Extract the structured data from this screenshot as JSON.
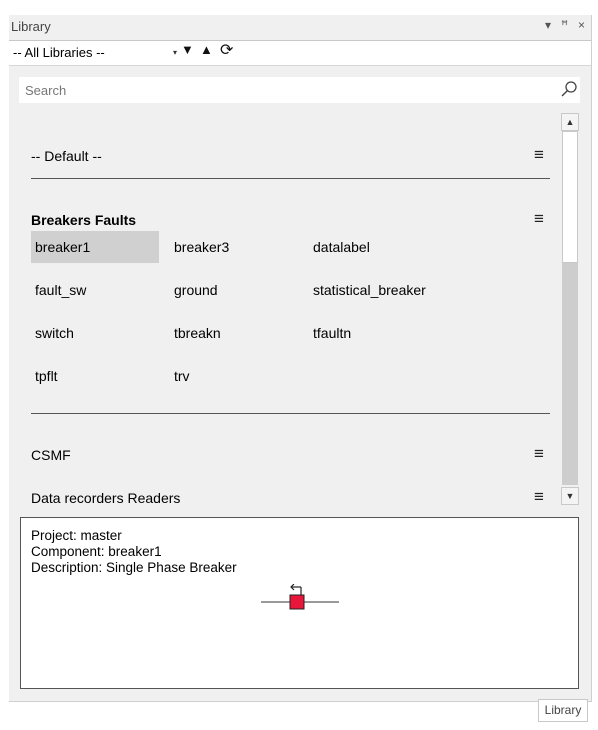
{
  "window": {
    "title": "Library",
    "dropdown_icon": "▾",
    "pin_icon": "ꟸ",
    "close_icon": "×"
  },
  "toolbar": {
    "library_select": "-- All Libraries --",
    "down_icon": "▼",
    "up_icon": "▲",
    "refresh_icon": "⟳"
  },
  "search": {
    "placeholder": "Search"
  },
  "categories": {
    "default": "-- Default --",
    "breakers": "Breakers Faults",
    "csmf": "CSMF",
    "data_recorders": "Data recorders Readers",
    "menu_icon": "≡"
  },
  "breakers_items": [
    "breaker1",
    "breaker3",
    "datalabel",
    "fault_sw",
    "ground",
    "statistical_breaker",
    "switch",
    "tbreakn",
    "tfaultn",
    "tpflt",
    "trv"
  ],
  "description": {
    "project": "Project: master",
    "component": "Component: breaker1",
    "description": "Description: Single Phase Breaker"
  },
  "footer": {
    "tab": "Library"
  },
  "colors": {
    "breaker_symbol": "#e8163b",
    "selected_bg": "#d0d0d0"
  }
}
